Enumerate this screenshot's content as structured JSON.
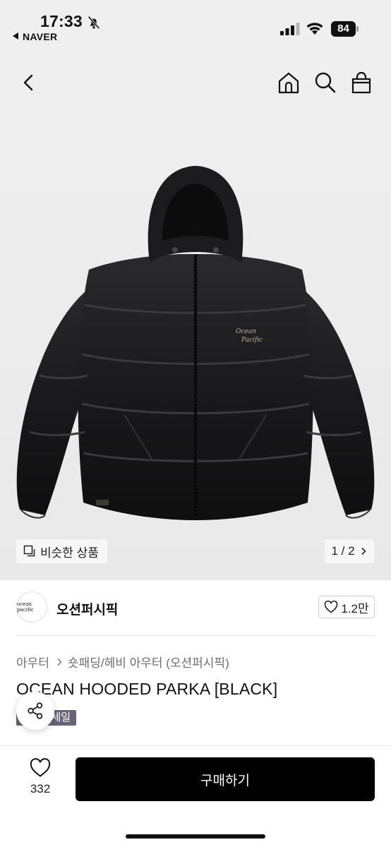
{
  "status_bar": {
    "time": "17:33",
    "back_app": "NAVER",
    "battery": "84"
  },
  "gallery": {
    "similar_label": "비슷한 상품",
    "pager": "1 / 2"
  },
  "brand": {
    "logo_text": "ocean pacific",
    "name": "오션퍼시픽",
    "likes": "1.2만"
  },
  "product": {
    "category": "아우터",
    "subcategory": "숏패딩/헤비 아우터 (오션퍼시픽)",
    "title": "OCEAN HOODED PARKA [BLACK]",
    "badge": "브랜드세일"
  },
  "bottom_bar": {
    "wish_count": "332",
    "buy_label": "구매하기"
  }
}
